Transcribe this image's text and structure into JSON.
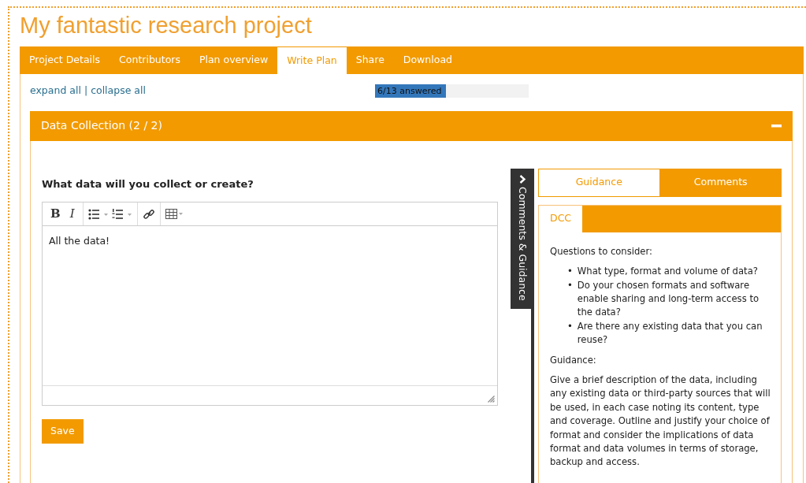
{
  "title": "My fantastic research project",
  "tabs": [
    {
      "label": "Project Details",
      "selected": false
    },
    {
      "label": "Contributors",
      "selected": false
    },
    {
      "label": "Plan overview",
      "selected": false
    },
    {
      "label": "Write Plan",
      "selected": true
    },
    {
      "label": "Share",
      "selected": false
    },
    {
      "label": "Download",
      "selected": false
    }
  ],
  "expand_link": "expand all",
  "separator": "|",
  "collapse_link": "collapse all",
  "progress": {
    "label": "6/13 answered",
    "level": 0.46
  },
  "section": {
    "title": "Data Collection (2 / 2)",
    "expanded": true,
    "question": "What data will you collect or create?",
    "toolbar": {
      "bold": "B",
      "italic": "I"
    },
    "answer": "All the data!",
    "save": "Save",
    "side_tab": {
      "label": "Comments & Guidance"
    },
    "panel_tabs": [
      {
        "label": "Guidance",
        "selected": true
      },
      {
        "label": "Comments",
        "selected": false
      }
    ],
    "guidance_tabs": [
      {
        "label": "DCC",
        "selected": true
      }
    ],
    "questions_heading": "Questions to consider:",
    "bullet": "•",
    "questions": [
      "What type, format and volume of data?",
      "Do your chosen formats and software enable sharing and long-term access to the data?",
      "Are there any existing data that you can reuse?"
    ],
    "guidance_heading": "Guidance:",
    "guidance_text": "Give a brief description of the data, including any existing data or third-party sources that will be used, in each case noting its content, type and coverage. Outline and justify your choice of format and consider the implications of data format and data volumes in terms of storage, backup and access."
  }
}
